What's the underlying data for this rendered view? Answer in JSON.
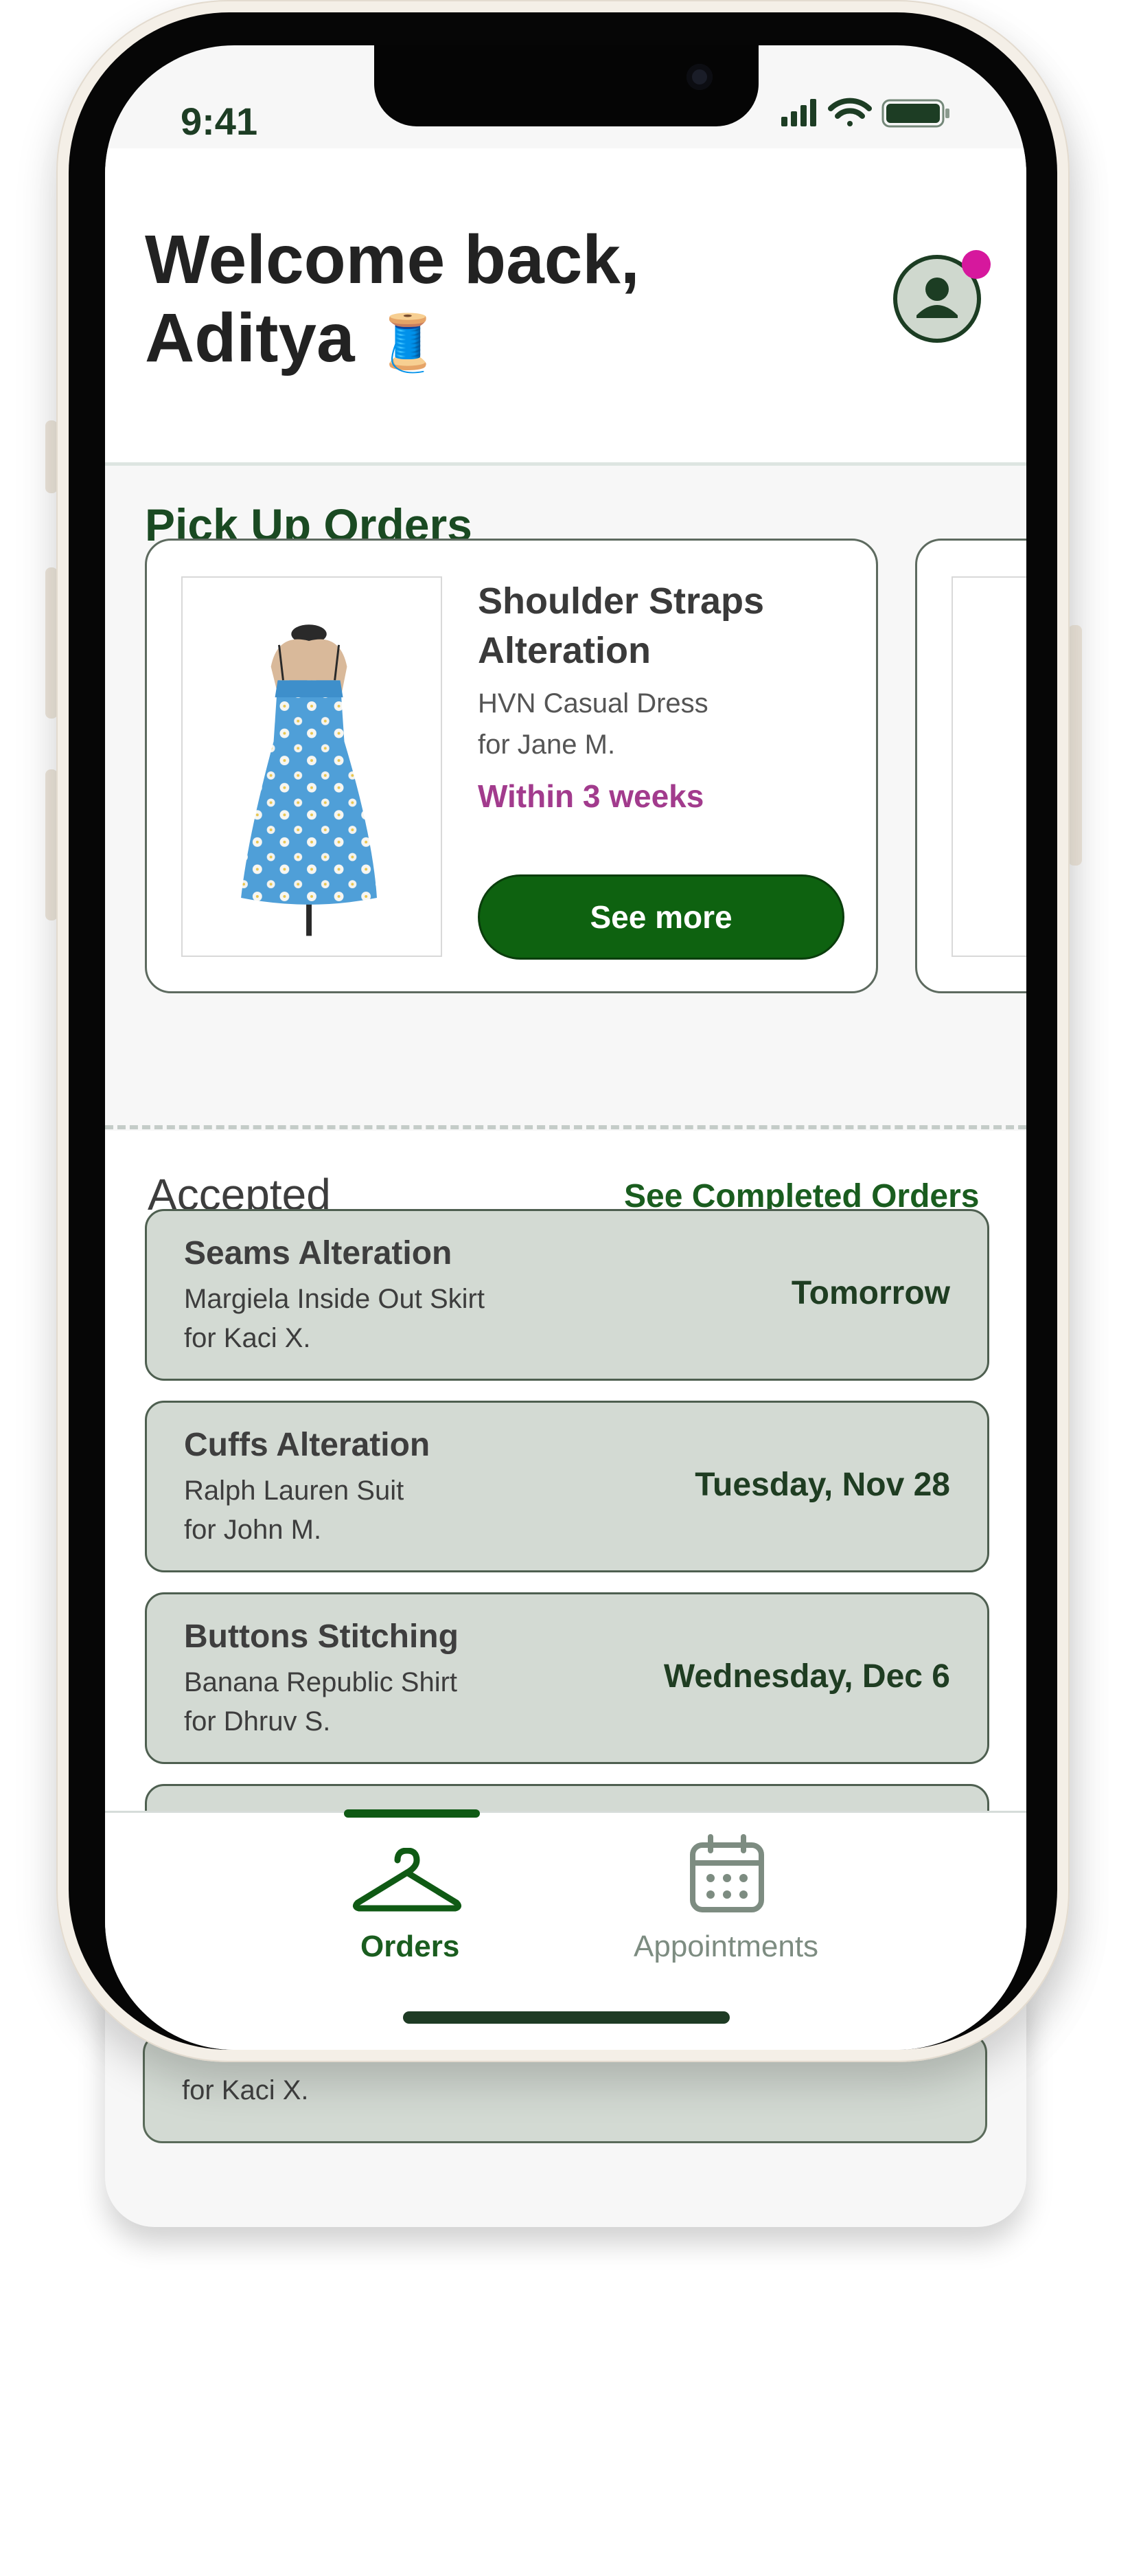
{
  "status_bar": {
    "time": "9:41"
  },
  "header": {
    "greeting_line1": "Welcome back,",
    "greeting_line2": "Aditya",
    "greeting_emoji": "🧵",
    "avatar_icon": "user-icon",
    "notification_color": "#d6189d"
  },
  "pickup": {
    "section_title": "Pick Up Orders",
    "orders": [
      {
        "title": "Shoulder Straps Alteration",
        "garment": "HVN Casual Dress",
        "customer": "for Jane M.",
        "due": "Within 3 weeks",
        "button_label": "See more"
      }
    ]
  },
  "accepted": {
    "title": "Accepted",
    "link_label": "See Completed Orders",
    "orders": [
      {
        "title": "Seams Alteration",
        "garment": "Margiela Inside Out Skirt",
        "customer": "for Kaci X.",
        "date": "Tomorrow"
      },
      {
        "title": "Cuffs Alteration",
        "garment": "Ralph Lauren Suit",
        "customer": "for John M.",
        "date": "Tuesday, Nov 28"
      },
      {
        "title": "Buttons Stitching",
        "garment": "Banana Republic Shirt",
        "customer": "for Dhruv S.",
        "date": "Wednesday, Dec 6"
      }
    ],
    "overflow_customer": "for Kaci X."
  },
  "tabbar": {
    "tabs": [
      {
        "label": "Orders",
        "icon": "hanger-icon",
        "active": true
      },
      {
        "label": "Appointments",
        "icon": "calendar-icon",
        "active": false
      }
    ]
  },
  "colors": {
    "brand_green": "#0e6210",
    "due_magenta": "#a23b8d",
    "card_sage": "#d3dad3"
  }
}
